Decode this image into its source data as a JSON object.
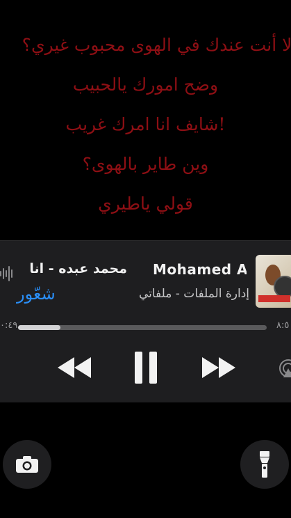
{
  "lyrics": [
    "إلا أنت عندك في الهوى محبوب غيري؟",
    "وضح امورك يالحبيب",
    "شايف انا امرك غريب!",
    "وين طاير بالهوى؟",
    "قولي ياطيري"
  ],
  "player": {
    "title_arabic": "محمد عبده - انا",
    "title_latin": "Mohamed A",
    "subtitle": "إدارة الملفات - ملفاتي",
    "brand": "شعّور",
    "time_left": "٠:٤٩",
    "time_right": "٨:٥",
    "progress": 0.17
  },
  "colors": {
    "lyrics": "#8e0f14",
    "accent": "#2a8ef6",
    "panel": "#1e1e20"
  },
  "icons": {
    "controls": [
      "rewind-icon",
      "pause-icon",
      "fast-forward-icon",
      "airplay-icon"
    ],
    "bottom": [
      "camera-icon",
      "flashlight-icon"
    ]
  }
}
